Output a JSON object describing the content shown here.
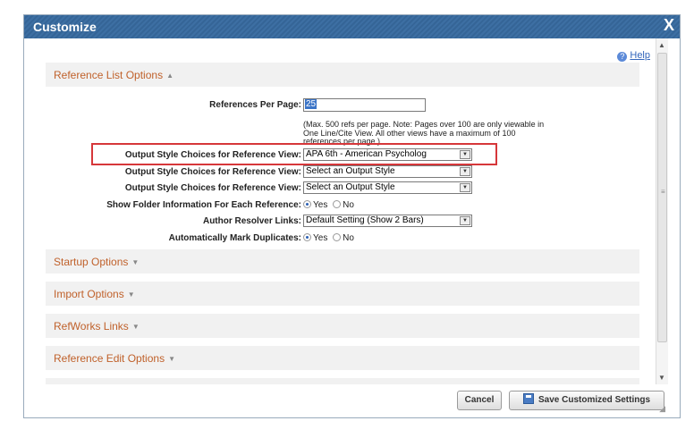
{
  "dialog": {
    "title": "Customize",
    "close_glyph": "X",
    "help_label": "Help"
  },
  "reference_list": {
    "header": "Reference List Options",
    "expanded_arrow": "▲",
    "refs_per_page_label": "References Per Page:",
    "refs_per_page_value": "25",
    "refs_note": "(Max. 500 refs per page. Note: Pages over 100 are only viewable in One Line/Cite View. All other views have a maximum of 100 references per page.)",
    "output_style_rows": [
      {
        "label": "Output Style Choices for Reference View:",
        "value": "APA 6th - American Psycholog"
      },
      {
        "label": "Output Style Choices for Reference View:",
        "value": "Select an Output Style"
      },
      {
        "label": "Output Style Choices for Reference View:",
        "value": "Select an Output Style"
      }
    ],
    "show_folder_label": "Show Folder Information For Each Reference:",
    "show_folder_selected": "Yes",
    "author_resolver_label": "Author Resolver Links:",
    "author_resolver_value": "Default Setting (Show 2 Bars)",
    "auto_mark_label": "Automatically Mark Duplicates:",
    "auto_mark_selected": "Yes",
    "yes_label": "Yes",
    "no_label": "No"
  },
  "collapsed_sections": [
    {
      "label": "Startup Options"
    },
    {
      "label": "Import Options"
    },
    {
      "label": "RefWorks Links"
    },
    {
      "label": "Reference Edit Options"
    }
  ],
  "collapsed_arrow": "▼",
  "footer": {
    "cancel_label": "Cancel",
    "save_label": "Save Customized Settings"
  },
  "colors": {
    "title_bar": "#3d6fa3",
    "section_label": "#c0612b",
    "highlight_box": "#d6373a",
    "link": "#3366bb"
  }
}
